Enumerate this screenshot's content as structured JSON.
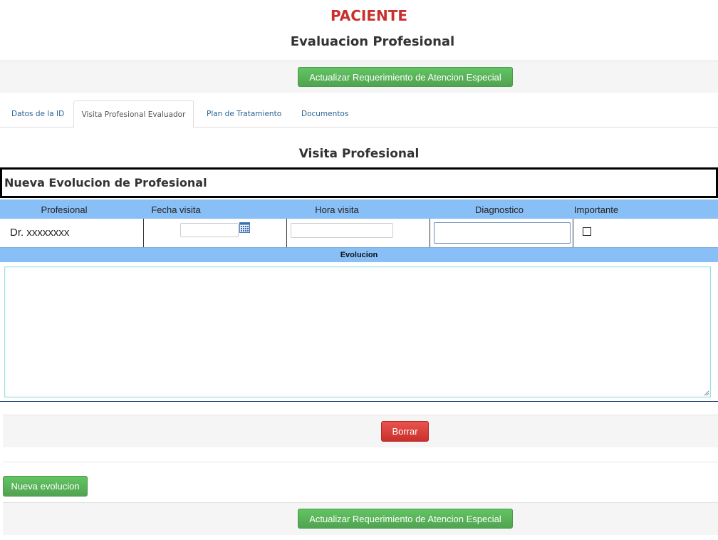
{
  "header": {
    "title": "PACIENTE",
    "subtitle": "Evaluacion Profesional"
  },
  "actions": {
    "update_label": "Actualizar Requerimiento de Atencion Especial"
  },
  "tabs": [
    {
      "label": "Datos de la ID",
      "active": false
    },
    {
      "label": "Visita Profesional Evaluador",
      "active": true
    },
    {
      "label": "Plan de Tratamiento",
      "active": false
    },
    {
      "label": "Documentos",
      "active": false
    }
  ],
  "section": {
    "title": "Visita Profesional",
    "box_title": "Nueva Evolucion de Profesional"
  },
  "table": {
    "headers": [
      "Profesional",
      "Fecha visita",
      "Hora visita",
      "Diagnostico",
      "Importante"
    ],
    "row": {
      "profesional": "Dr. xxxxxxxx",
      "fecha": "",
      "hora": "",
      "diagnostico": "",
      "importante": false
    }
  },
  "evolucion": {
    "label": "Evolucion",
    "value": ""
  },
  "buttons": {
    "delete_label": "Borrar",
    "new_label": "Nueva evolucion"
  },
  "colors": {
    "title_red": "#c9302c",
    "header_blue": "#88bff7",
    "green": "#5cb85c",
    "red": "#d9534f"
  }
}
